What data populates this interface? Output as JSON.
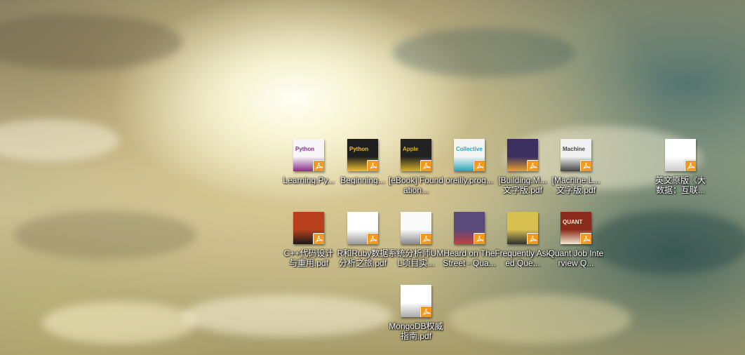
{
  "desktop": {
    "icons": [
      {
        "label": "Learning.Py...",
        "cover": "#f6f6f6",
        "accent": "#8a2f8a",
        "title": "Python"
      },
      {
        "label": "Beginning...",
        "cover": "#1e1e1e",
        "accent": "#f0c030",
        "title": "Python"
      },
      {
        "label": "[eBook] Foundation...",
        "cover": "#222222",
        "accent": "#d8b028",
        "title": "Apple"
      },
      {
        "label": "oreilly.prog...",
        "cover": "#f4f4f4",
        "accent": "#2aa3b8",
        "title": "Collective"
      },
      {
        "label": "[Building.M... 文字版.pdf",
        "cover": "#3a3060",
        "accent": "#e8a030",
        "title": ""
      },
      {
        "label": "[Machine.L... 文字版.pdf",
        "cover": "#f0f0f0",
        "accent": "#444444",
        "title": "Machine"
      },
      {
        "label": "英文原版《大数据：互联...",
        "cover": "#ffffff",
        "accent": "#cccccc",
        "title": ""
      },
      {
        "label": "C++代码设计与重用.pdf",
        "cover": "#b8401c",
        "accent": "#1a1a1a",
        "title": ""
      },
      {
        "label": "R和Ruby数据分析之旅.pdf",
        "cover": "#ffffff",
        "accent": "#999999",
        "title": ""
      },
      {
        "label": "系统分析师UML项目实...",
        "cover": "#fafafa",
        "accent": "#888888",
        "title": ""
      },
      {
        "label": "Heard on The Street - Qua...",
        "cover": "#5a4a7a",
        "accent": "#c04040",
        "title": ""
      },
      {
        "label": "Frequently Asked Que...",
        "cover": "#d8c050",
        "accent": "#303030",
        "title": ""
      },
      {
        "label": "Quant Job Interview Q...",
        "cover": "#8a2a1a",
        "accent": "#f0e8d0",
        "title": "QUANT"
      },
      {
        "label": "MongoDB权威指南.pdf",
        "cover": "#ffffff",
        "accent": "#aaaaaa",
        "title": ""
      }
    ]
  }
}
